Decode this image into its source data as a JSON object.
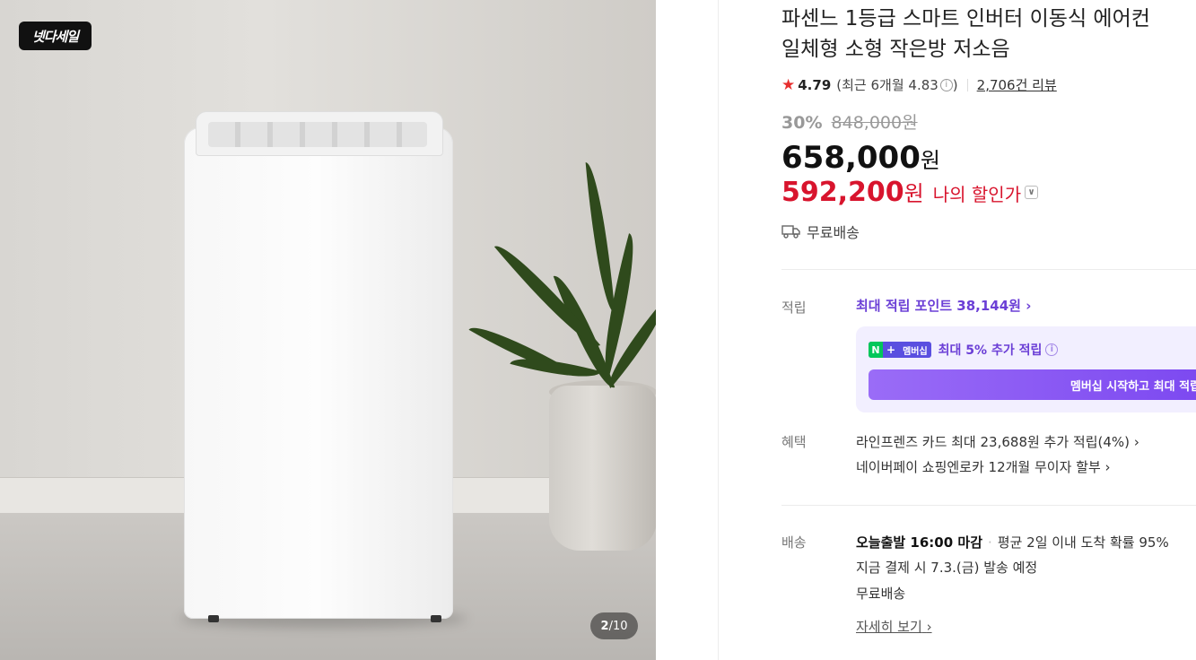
{
  "gallery": {
    "badge_text": "넷다세일",
    "counter_current": "2",
    "counter_total": "/10"
  },
  "product": {
    "title_line1": "파센느 1등급 스마트 인버터 이동식 에어컨",
    "title_line2": "일체형 소형 작은방 저소음",
    "rating": "4.79",
    "recent_rating": "(최근 6개월 4.83",
    "recent_rating_close": ")",
    "review_count": "2,706건 리뷰",
    "discount_percent": "30%",
    "original_price": "848,000원",
    "price": "658,000",
    "price_unit": "원",
    "my_price": "592,200",
    "my_price_unit": "원",
    "my_price_label": "나의 할인가",
    "free_shipping": "무료배송"
  },
  "points": {
    "label": "적립",
    "max_points": "최대 적립 포인트 38,144원",
    "membership_badge_n": "N",
    "membership_badge_plus": "+",
    "membership_badge_text": "멤버십",
    "membership_extra": "최대 5% 추가 적립",
    "membership_button": "멤버십 시작하고 최대 적립"
  },
  "benefits": {
    "label": "혜택",
    "card": "라인프렌즈 카드 최대 23,688원 추가 적립(4%)",
    "installment": "네이버페이 쇼핑엔로카 12개월 무이자 할부"
  },
  "shipping": {
    "label": "배송",
    "dispatch": "오늘출발 16:00 마감",
    "arrival": "평균 2일 이내 도착 확률 95%",
    "schedule": "지금 결제 시 7.3.(금) 발송 예정",
    "fee": "무료배송",
    "detail_link": "자세히 보기"
  },
  "colors": {
    "accent_red": "#d8142d",
    "accent_purple": "#6b3fd6",
    "star": "#e72e2e"
  }
}
